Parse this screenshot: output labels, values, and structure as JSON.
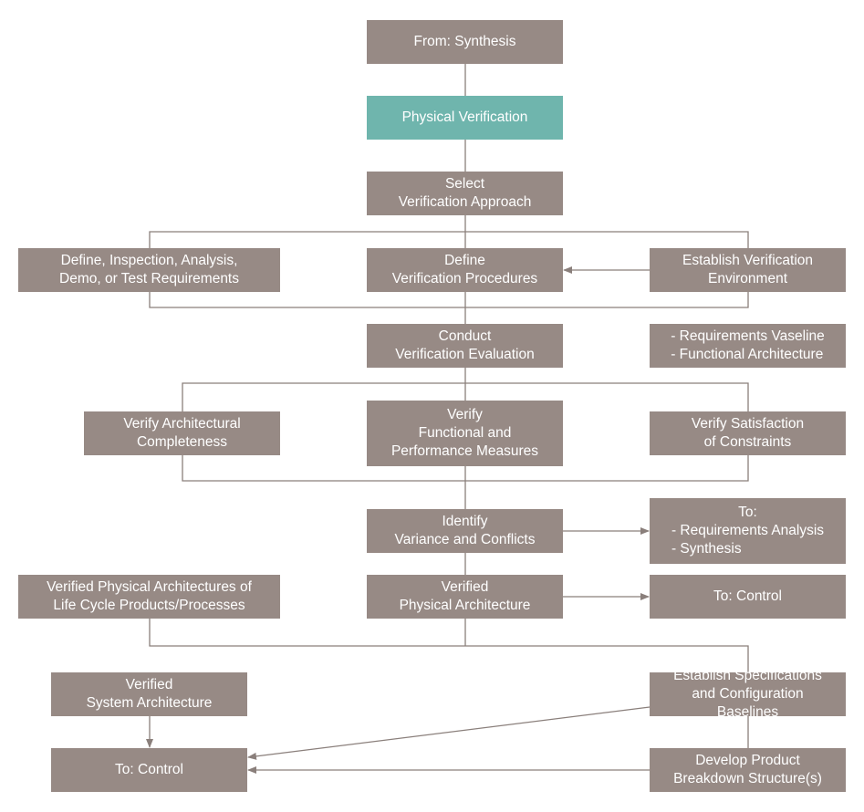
{
  "colors": {
    "node": "#978a85",
    "highlight": "#6fb5ad",
    "connector": "#8a7f7b"
  },
  "nodes": {
    "from_synthesis": "From: Synthesis",
    "physical_verification": "Physical Verification",
    "select_approach": "Select\nVerification Approach",
    "define_requirements": "Define, Inspection, Analysis,\nDemo, or Test Requirements",
    "define_procedures": "Define\nVerification Procedures",
    "establish_environment": "Establish Verification\nEnvironment",
    "conduct_evaluation": "Conduct\nVerification Evaluation",
    "requirements_baseline": "- Requirements Vaseline\n- Functional Architecture",
    "verify_architectural": "Verify Architectural\nCompleteness",
    "verify_functional": "Verify\nFunctional and\nPerformance Measures",
    "verify_constraints": "Verify Satisfaction\nof Constraints",
    "identify_variance": "Identify\nVariance and Conflicts",
    "to_requirements_title": "To:",
    "to_requirements_list": "- Requirements Analysis\n- Synthesis",
    "verified_life_cycle": "Verified Physical Architectures of\nLife Cycle Products/Processes",
    "verified_physical": "Verified\nPhysical Architecture",
    "to_control_right": "To: Control",
    "verified_system": "Verified\nSystem Architecture",
    "establish_specs": "Establish Specifications\nand Configuration\nBaselines",
    "to_control_left": "To: Control",
    "develop_pbs": "Develop Product\nBreakdown Structure(s)"
  }
}
